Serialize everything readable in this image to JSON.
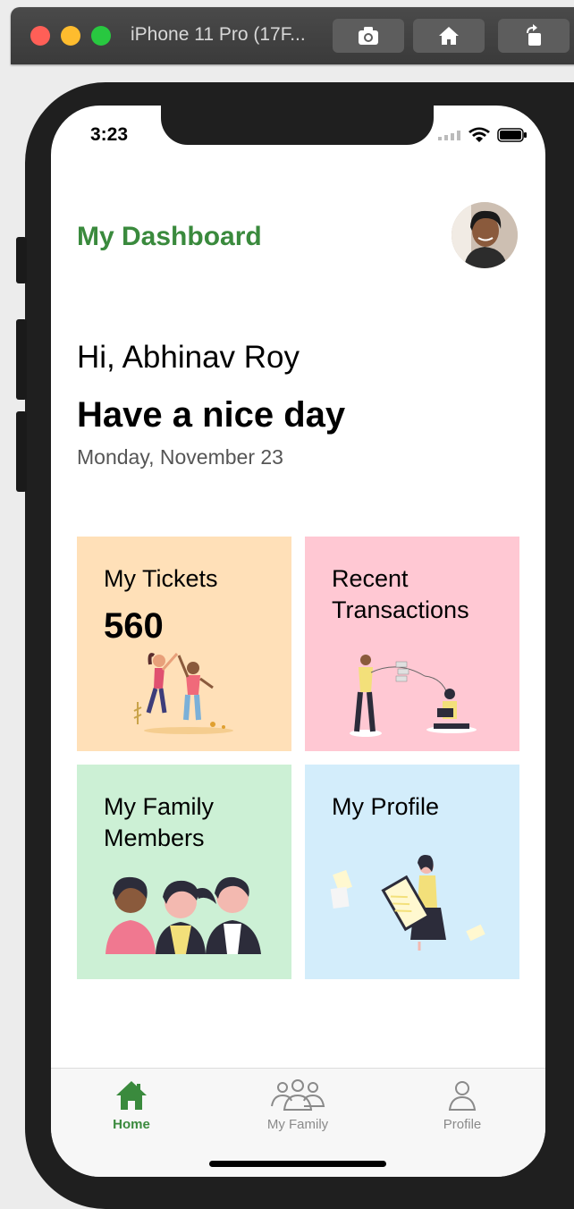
{
  "window": {
    "title": "iPhone 11 Pro (17F...",
    "buttons": [
      {
        "icon": "camera-icon"
      },
      {
        "icon": "home-icon"
      },
      {
        "icon": "rotate-icon"
      }
    ]
  },
  "status_bar": {
    "time": "3:23",
    "icons": [
      "signal-icon",
      "wifi-icon",
      "battery-icon"
    ]
  },
  "header": {
    "title": "My Dashboard",
    "title_color": "#3a8a3d"
  },
  "greeting": {
    "hello": "Hi, Abhinav Roy",
    "message": "Have a nice day",
    "date": "Monday, November 23"
  },
  "cards": [
    {
      "title": "My Tickets",
      "value": "560",
      "color": "#ffe0b8",
      "icon": "dancing-people-illustration"
    },
    {
      "title": "Recent\nTransactions",
      "color": "#ffc8d3",
      "icon": "transactions-illustration"
    },
    {
      "title": "My Family\nMembers",
      "color": "#ccf0d5",
      "icon": "family-members-illustration"
    },
    {
      "title": "My Profile",
      "color": "#d3edfb",
      "icon": "profile-illustration"
    }
  ],
  "tabs": [
    {
      "label": "Home",
      "icon": "home-icon",
      "active": true,
      "color": "#3a8a3d"
    },
    {
      "label": "My Family",
      "icon": "family-icon",
      "active": false,
      "color": "#8a8a8a"
    },
    {
      "label": "Profile",
      "icon": "person-icon",
      "active": false,
      "color": "#8a8a8a"
    }
  ]
}
